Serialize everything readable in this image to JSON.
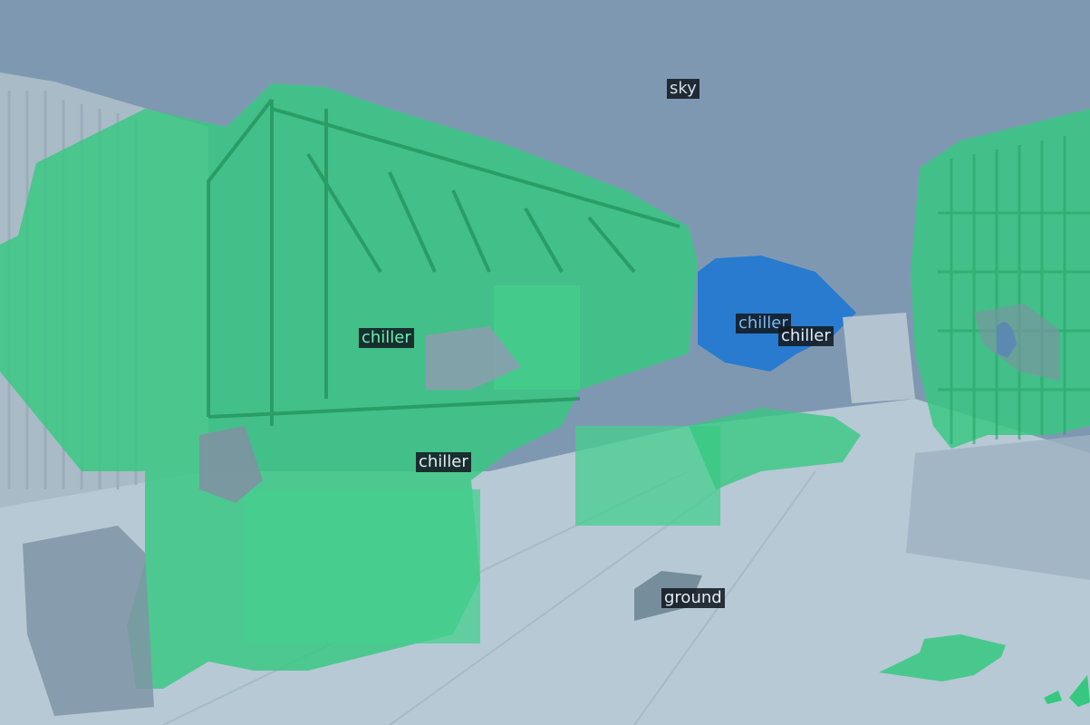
{
  "image": {
    "description_kind": "semantic segmentation overlay on outdoor photo of chiller units",
    "overlay_colors": {
      "sky": "#7f98b2",
      "ground": "#b4c8d4",
      "chiller_primary": "#2ecc80",
      "chiller_secondary": "#1f78d2",
      "unlabeled": "#8a9aa8"
    }
  },
  "labels": [
    {
      "id": "sky",
      "text": "sky",
      "color": "#d8dee6"
    },
    {
      "id": "chiller-left",
      "text": "chiller",
      "color": "#6ef0b0"
    },
    {
      "id": "chiller-blue",
      "text": "chiller",
      "color": "#7fb8f0"
    },
    {
      "id": "chiller-right",
      "text": "chiller",
      "color": "#e6ecf2"
    },
    {
      "id": "chiller-bottom",
      "text": "chiller",
      "color": "#e6ecf2"
    },
    {
      "id": "ground",
      "text": "ground",
      "color": "#e6ecf2"
    }
  ]
}
